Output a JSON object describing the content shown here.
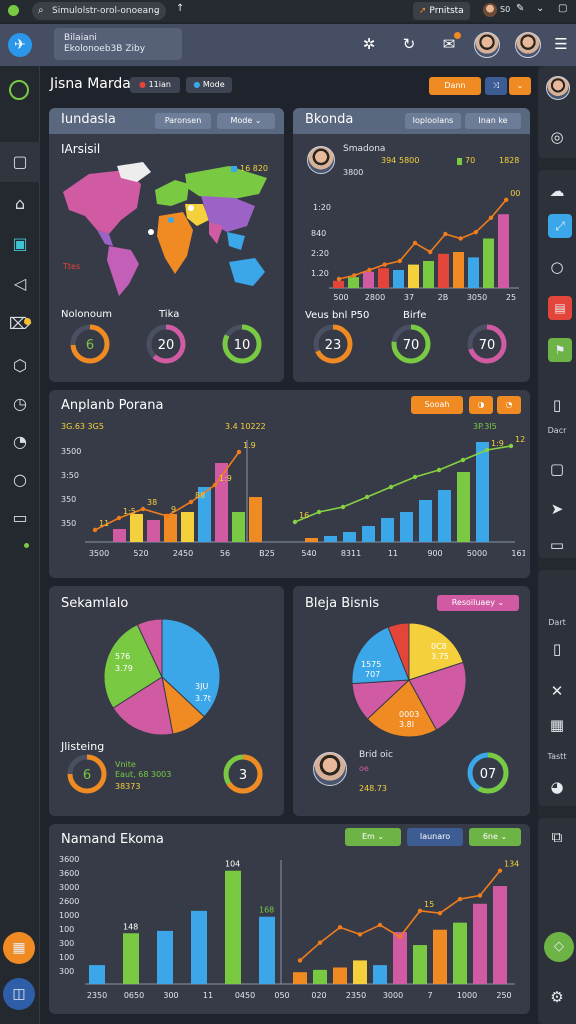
{
  "topbar": {
    "search_text": "Simulolstr-orol-onoeang",
    "search_sub": "↑",
    "chip_label": "Prnitsta",
    "chip_icon": "arrow-up-icon",
    "badge_text": "S0"
  },
  "header": {
    "brand_line1": "Bilaiani",
    "brand_line2": "Ekolonoeb3B Ziby"
  },
  "page": {
    "title": "Jisna Marda",
    "tag1": "11ian",
    "tag2": "Mode",
    "action_label": "Dann"
  },
  "panel1": {
    "title": "Iundasla",
    "pill1": "Paronsen",
    "pill2": "Mode",
    "section_title": "IArsisil",
    "map_legend": "16 820",
    "map_note": "Ttes",
    "label_left": "Nolonoum",
    "label_mid": "Tika",
    "donuts": [
      {
        "value": "6",
        "pct": 0.74
      },
      {
        "value": "20",
        "pct": 0.62
      },
      {
        "value": "10",
        "pct": 0.83
      }
    ]
  },
  "panel2": {
    "title": "Bkonda",
    "pill1": "Ioploolans",
    "pill2": "Inan ke",
    "person_name": "Smadona",
    "person_line": "3800",
    "stat_a": "394",
    "stat_b": "5800",
    "stat_c": "70",
    "stat_d": "1828",
    "chart_y_top": "1:20",
    "label_left": "Veus bnl P50",
    "label_right": "Birfe",
    "donuts": [
      {
        "value": "23",
        "pct": 0.68
      },
      {
        "value": "70",
        "pct": 0.77
      },
      {
        "value": "70",
        "pct": 0.7
      }
    ]
  },
  "panel3": {
    "title": "Anplanb Porana",
    "pill1": "Sooah",
    "header_left": "3G.63  3G5",
    "header_mid": "3.4 10222",
    "header_right": "3P.3I5"
  },
  "panel4": {
    "title": "Sekamlalo",
    "slice_label_a": "576",
    "slice_label_a2": "3.79",
    "slice_label_b": "3JU",
    "slice_label_b2": "3.7t",
    "sub_title": "Jlisteing",
    "detail1": "Vnite",
    "detail2": "Eaut,  68  3003",
    "detail3": "38373",
    "donut_left": "6",
    "donut_right": "3"
  },
  "panel5": {
    "title": "Bleja Bisnis",
    "pill": "Resoiluaey",
    "slice_label_a": "1575",
    "slice_label_a2": "707",
    "slice_label_b": "0C8",
    "slice_label_b2": "3.75",
    "slice_label_c": "0003",
    "slice_label_c2": "3.8I",
    "person_name": "Brid oic",
    "person_line1": "oe",
    "person_line2": "248.73",
    "donut": "07"
  },
  "panel6": {
    "title": "Namand Ekoma",
    "pill1": "Em",
    "pill2": "Iaunaro",
    "pill3": "6ne"
  },
  "rightnav": {
    "label_a": "Dacr",
    "label_b": "Dart",
    "label_c": "Tastt"
  },
  "colors": {
    "orange": "#f08a22",
    "green": "#7ac943",
    "blue": "#3ba7e8",
    "pink": "#d05ba2",
    "red": "#e4453a",
    "yellow": "#f4d13c",
    "line_orange": "#f07c1d",
    "line_green": "#86d142"
  },
  "chart_data": [
    {
      "type": "bar",
      "title": "",
      "x_ticks": [
        "500",
        "2800",
        "37",
        "2B",
        "3050",
        "25"
      ],
      "y_ticks": [
        "1:20",
        "840",
        "2:20",
        "1.20"
      ],
      "bars": [
        {
          "v": 0.08,
          "c": "red"
        },
        {
          "v": 0.12,
          "c": "green"
        },
        {
          "v": 0.18,
          "c": "pink"
        },
        {
          "v": 0.22,
          "c": "red"
        },
        {
          "v": 0.2,
          "c": "blue"
        },
        {
          "v": 0.26,
          "c": "yellow"
        },
        {
          "v": 0.3,
          "c": "green"
        },
        {
          "v": 0.38,
          "c": "red"
        },
        {
          "v": 0.4,
          "c": "orange"
        },
        {
          "v": 0.34,
          "c": "blue"
        },
        {
          "v": 0.55,
          "c": "green"
        },
        {
          "v": 0.82,
          "c": "pink"
        }
      ],
      "line": [
        0.1,
        0.14,
        0.2,
        0.26,
        0.3,
        0.5,
        0.4,
        0.6,
        0.55,
        0.62,
        0.78,
        0.98
      ],
      "line_labels": [
        "",
        "",
        "",
        "",
        "",
        "",
        "",
        "",
        "",
        "",
        "",
        "00"
      ]
    },
    {
      "type": "bar",
      "title": "Anplanb Porana",
      "x_ticks": [
        "3500",
        "520",
        "2450",
        "56",
        "B25",
        "540",
        "8311",
        "11",
        "900",
        "5000",
        "161"
      ],
      "y_ticks": [
        "3500",
        "3:50",
        "350",
        "350"
      ],
      "left": {
        "bars": [
          {
            "v": 0.13,
            "c": "pink"
          },
          {
            "v": 0.28,
            "c": "yellow"
          },
          {
            "v": 0.22,
            "c": "pink"
          },
          {
            "v": 0.28,
            "c": "orange"
          },
          {
            "v": 0.3,
            "c": "yellow"
          },
          {
            "v": 0.55,
            "c": "blue"
          },
          {
            "v": 0.79,
            "c": "pink"
          },
          {
            "v": 0.3,
            "c": "green"
          },
          {
            "v": 0.45,
            "c": "orange"
          }
        ],
        "line": [
          0.12,
          0.24,
          0.33,
          0.26,
          0.4,
          0.57,
          0.9
        ],
        "labels": [
          "11",
          "1:5",
          "38",
          "9",
          "88",
          "1:9",
          "1.9"
        ]
      },
      "right": {
        "bars": [
          {
            "v": 0.04,
            "c": "orange"
          },
          {
            "v": 0.06,
            "c": "blue"
          },
          {
            "v": 0.1,
            "c": "blue"
          },
          {
            "v": 0.16,
            "c": "blue"
          },
          {
            "v": 0.24,
            "c": "blue"
          },
          {
            "v": 0.3,
            "c": "blue"
          },
          {
            "v": 0.42,
            "c": "blue"
          },
          {
            "v": 0.52,
            "c": "blue"
          },
          {
            "v": 0.7,
            "c": "green"
          },
          {
            "v": 1.0,
            "c": "blue"
          }
        ],
        "line": [
          0.2,
          0.3,
          0.35,
          0.45,
          0.55,
          0.65,
          0.72,
          0.82,
          0.92,
          0.96
        ],
        "labels": [
          "16",
          "",
          "",
          "",
          "",
          "",
          "",
          "",
          "1:9",
          "12"
        ]
      }
    },
    {
      "type": "pie",
      "title": "Sekamlalo",
      "slices": [
        {
          "v": 0.37,
          "c": "blue"
        },
        {
          "v": 0.1,
          "c": "orange"
        },
        {
          "v": 0.19,
          "c": "pink"
        },
        {
          "v": 0.27,
          "c": "green"
        },
        {
          "v": 0.07,
          "c": "pink"
        }
      ]
    },
    {
      "type": "pie",
      "title": "Bleja Bisnis",
      "slices": [
        {
          "v": 0.2,
          "c": "yellow"
        },
        {
          "v": 0.22,
          "c": "pink"
        },
        {
          "v": 0.21,
          "c": "orange"
        },
        {
          "v": 0.11,
          "c": "pink"
        },
        {
          "v": 0.2,
          "c": "blue"
        },
        {
          "v": 0.06,
          "c": "red"
        }
      ]
    },
    {
      "type": "bar",
      "title": "Namand Ekoma",
      "x_ticks": [
        "2350",
        "0650",
        "300",
        "11",
        "0450",
        "050",
        "020",
        "2350",
        "3000",
        "7",
        "1000",
        "250"
      ],
      "y_ticks": [
        "3600",
        "3600",
        "3000",
        "2600",
        "1000",
        "100",
        "300",
        "100",
        "300"
      ],
      "left": {
        "bars": [
          {
            "v": 0.16,
            "c": "blue"
          },
          {
            "v": 0.43,
            "c": "green"
          },
          {
            "v": 0.45,
            "c": "blue"
          },
          {
            "v": 0.62,
            "c": "blue"
          },
          {
            "v": 0.96,
            "c": "green"
          },
          {
            "v": 0.57,
            "c": "blue"
          }
        ],
        "labels": [
          "",
          "148",
          "",
          "",
          "104",
          "168"
        ]
      },
      "right": {
        "bars": [
          {
            "v": 0.1,
            "c": "orange"
          },
          {
            "v": 0.12,
            "c": "green"
          },
          {
            "v": 0.14,
            "c": "orange"
          },
          {
            "v": 0.2,
            "c": "yellow"
          },
          {
            "v": 0.16,
            "c": "blue"
          },
          {
            "v": 0.44,
            "c": "pink"
          },
          {
            "v": 0.33,
            "c": "green"
          },
          {
            "v": 0.46,
            "c": "orange"
          },
          {
            "v": 0.52,
            "c": "green"
          },
          {
            "v": 0.68,
            "c": "pink"
          },
          {
            "v": 0.83,
            "c": "pink"
          }
        ],
        "line": [
          0.2,
          0.35,
          0.48,
          0.42,
          0.5,
          0.4,
          0.62,
          0.6,
          0.72,
          0.75,
          0.96
        ],
        "labels": [
          "",
          "",
          "",
          "",
          "",
          "",
          "15",
          "",
          "",
          "",
          "134"
        ]
      }
    }
  ]
}
